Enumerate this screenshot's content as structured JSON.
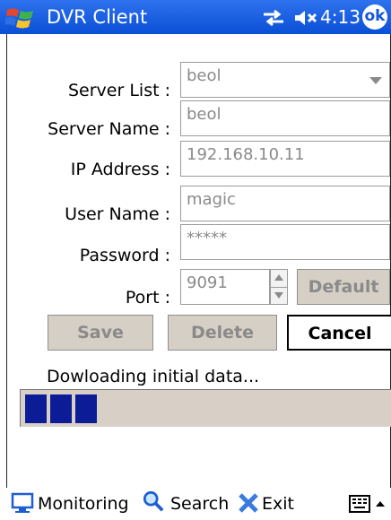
{
  "titlebar": {
    "app_title": "DVR Client",
    "clock": "4:13",
    "ok_label": "ok"
  },
  "form": {
    "server_list": {
      "label": "Server List :",
      "value": "beol"
    },
    "server_name": {
      "label": "Server Name :",
      "value": "beol"
    },
    "ip_address": {
      "label": "IP Address :",
      "value": "192.168.10.11"
    },
    "user_name": {
      "label": "User Name :",
      "value": "magic"
    },
    "password": {
      "label": "Password :",
      "value": "*****"
    },
    "port": {
      "label": "Port :",
      "value": "9091",
      "default_label": "Default"
    }
  },
  "actions": {
    "save_label": "Save",
    "delete_label": "Delete",
    "cancel_label": "Cancel"
  },
  "progress": {
    "status_text": "Dowloading initial data...",
    "blocks_filled": 3
  },
  "taskbar": {
    "monitoring_label": "Monitoring",
    "search_label": "Search",
    "exit_label": "Exit"
  }
}
